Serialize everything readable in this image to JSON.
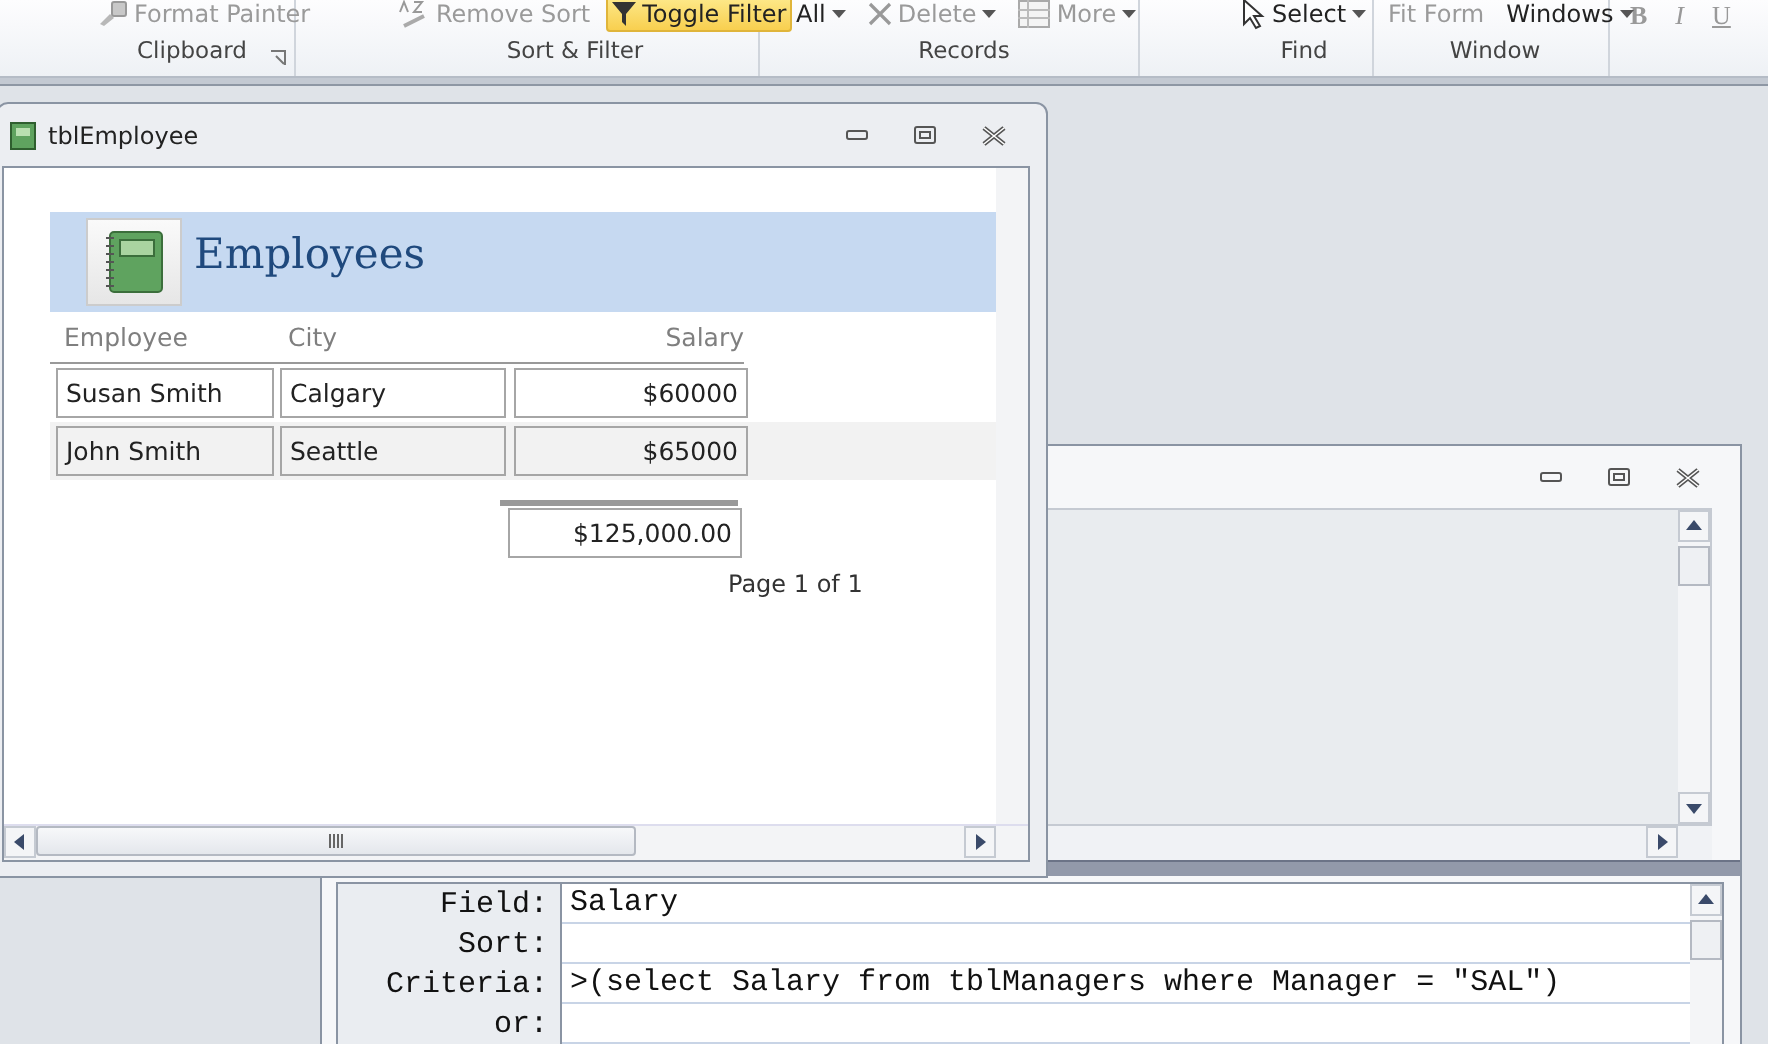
{
  "ribbon": {
    "groups": [
      {
        "label": "Clipboard",
        "launcher": true,
        "items": [
          {
            "label": "Format Painter",
            "kind": "button",
            "disabled": true
          }
        ]
      },
      {
        "label": "Sort & Filter",
        "items": [
          {
            "label": "Remove Sort",
            "kind": "button",
            "disabled": true
          },
          {
            "label": "Toggle Filter",
            "kind": "toggle",
            "disabled": false,
            "selected": true
          }
        ]
      },
      {
        "label": "Records",
        "items": [
          {
            "label": "All",
            "kind": "dropdown",
            "disabled": false
          },
          {
            "label": "Delete",
            "kind": "dropdown",
            "disabled": true
          },
          {
            "label": "More",
            "kind": "dropdown",
            "disabled": true
          }
        ]
      },
      {
        "label": "Find",
        "items": [
          {
            "label": "Select",
            "kind": "dropdown",
            "disabled": false
          }
        ]
      },
      {
        "label": "Window",
        "items": [
          {
            "label": "Fit Form",
            "kind": "button",
            "disabled": true
          },
          {
            "label": "Windows",
            "kind": "dropdown",
            "disabled": false
          }
        ]
      }
    ],
    "format_buttons": [
      "B",
      "I",
      "U"
    ]
  },
  "report_window": {
    "title": "tblEmployee",
    "report_title": "Employees",
    "columns": [
      "Employee",
      "City",
      "Salary"
    ],
    "rows": [
      [
        "Susan Smith",
        "Calgary",
        "$60000"
      ],
      [
        "John Smith",
        "Seattle",
        "$65000"
      ]
    ],
    "total": "$125,000.00",
    "page": "Page 1 of 1"
  },
  "query_window": {
    "grid": [
      {
        "label": "Field:",
        "value": "Salary"
      },
      {
        "label": "Sort:"
      },
      {
        "label": "Criteria:",
        "value": ">(select Salary from tblManagers where Manager = \"SAL\")"
      },
      {
        "label": "or:"
      }
    ]
  }
}
